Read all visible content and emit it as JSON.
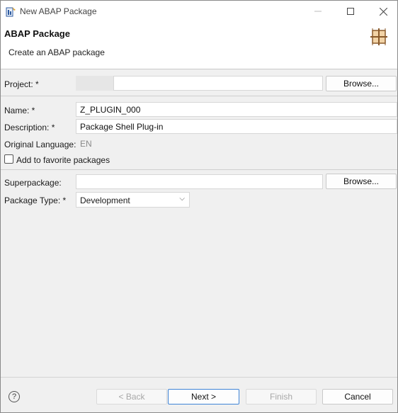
{
  "window": {
    "title": "New ABAP Package",
    "icon": "abap-package-wizard-icon"
  },
  "banner": {
    "title": "ABAP Package",
    "description": "Create an ABAP package",
    "icon": "package-grid-icon"
  },
  "form": {
    "project_label": "Project: *",
    "project_value": "",
    "project_browse": "Browse...",
    "name_label": "Name: *",
    "name_value": "Z_PLUGIN_000",
    "description_label": "Description: *",
    "description_value": "Package Shell Plug-in",
    "original_language_label": "Original Language:",
    "original_language_value": "EN",
    "favorite_label": "Add to favorite packages",
    "favorite_checked": false,
    "superpackage_label": "Superpackage:",
    "superpackage_value": "",
    "superpackage_browse": "Browse...",
    "package_type_label": "Package Type: *",
    "package_type_value": "Development"
  },
  "footer": {
    "help": "?",
    "back": "< Back",
    "next": "Next >",
    "finish": "Finish",
    "cancel": "Cancel"
  }
}
